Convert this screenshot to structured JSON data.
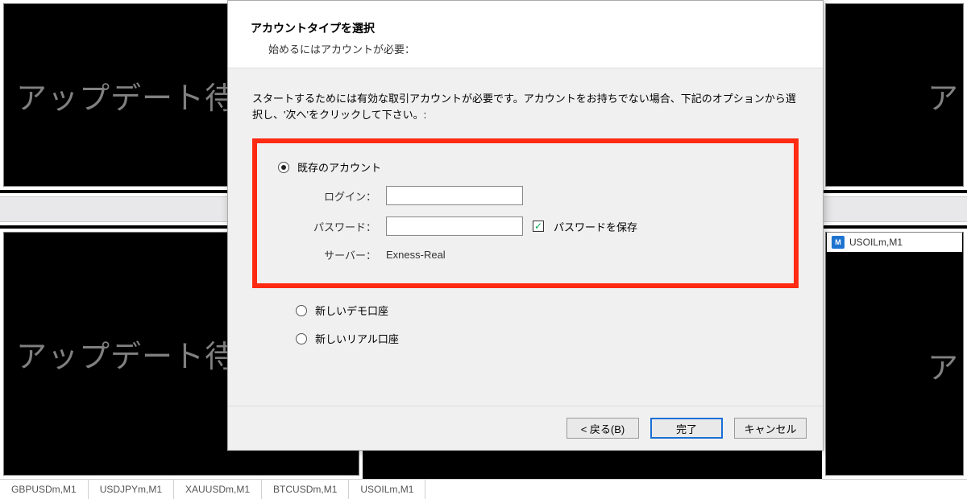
{
  "workspace": {
    "status_text": "アップデート待機",
    "status_text_right": "ア",
    "panel_title": "USOILm,M1"
  },
  "tabs": [
    "GBPUSDm,M1",
    "USDJPYm,M1",
    "XAUUSDm,M1",
    "BTCUSDm,M1",
    "USOILm,M1"
  ],
  "dialog": {
    "title": "アカウントタイプを選択",
    "subtitle": "始めるにはアカウントが必要：",
    "intro": "スタートするためには有効な取引アカウントが必要です。アカウントをお持ちでない場合、下記のオプションから選択し、'次へ'をクリックして下さい。:",
    "opt_existing": "既存のアカウント",
    "login_label": "ログイン：",
    "login_value": "",
    "password_label": "パスワード：",
    "password_value": "",
    "save_password": "パスワードを保存",
    "server_label": "サーバー：",
    "server_value": "Exness-Real",
    "opt_demo": "新しいデモ口座",
    "opt_real": "新しいリアル口座",
    "btn_back": "< 戻る(B)",
    "btn_finish": "完了",
    "btn_cancel": "キャンセル"
  }
}
